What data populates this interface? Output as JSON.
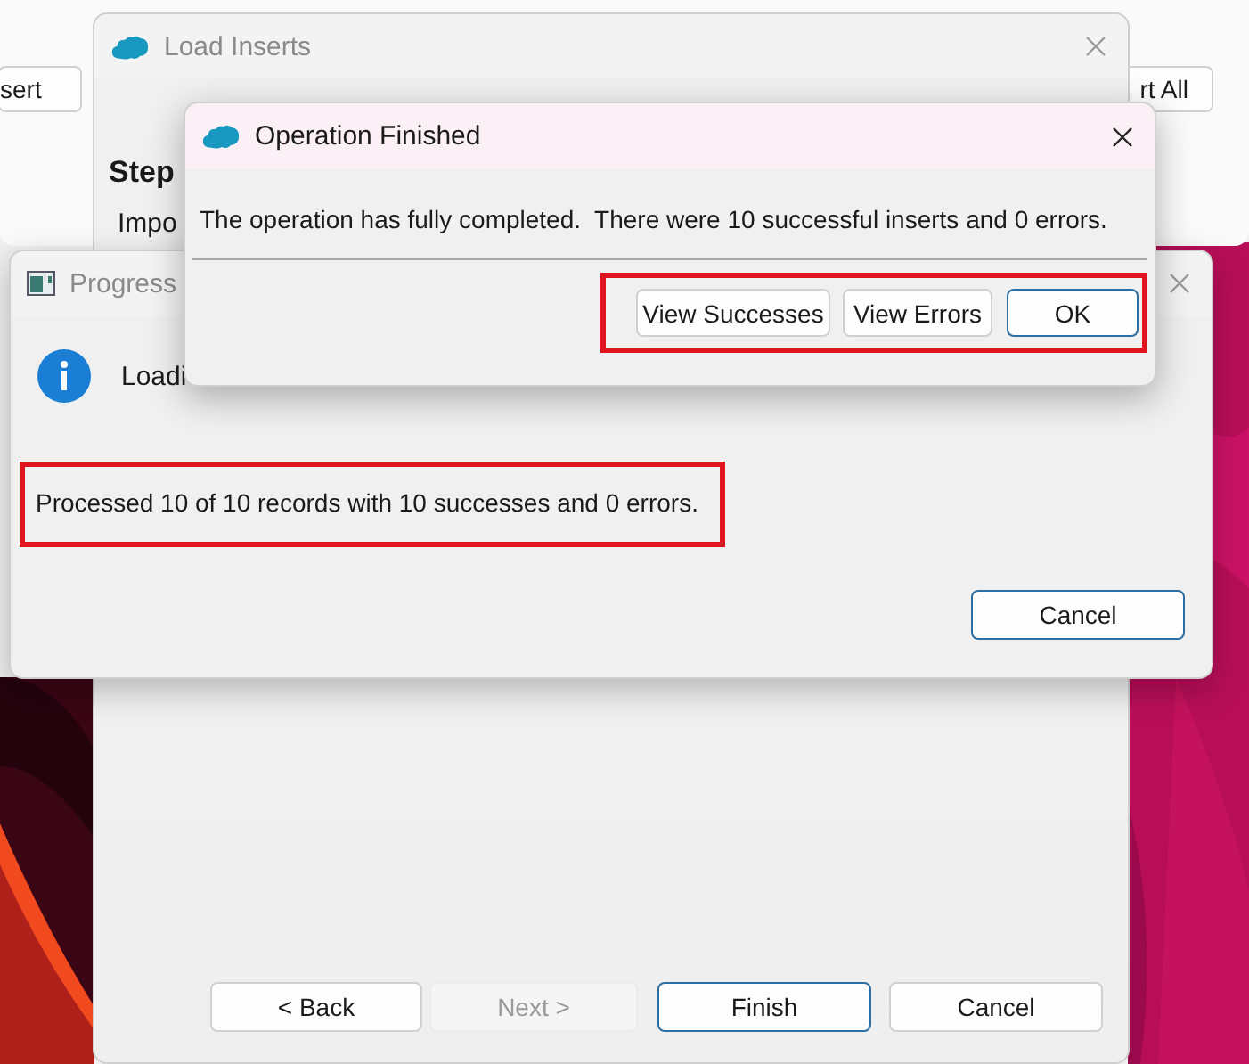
{
  "background_window": {
    "buttons": [
      {
        "label": "sert"
      },
      {
        "label": "rt All"
      }
    ]
  },
  "wizard": {
    "title": "Load Inserts",
    "active": false,
    "heading": "Step",
    "text": "Impo",
    "buttons": [
      {
        "label": "< Back",
        "disabled": false,
        "default": false
      },
      {
        "label": "Next >",
        "disabled": true,
        "default": false
      },
      {
        "label": "Finish",
        "disabled": false,
        "default": true
      },
      {
        "label": "Cancel",
        "disabled": false,
        "default": false
      }
    ]
  },
  "progress": {
    "title": "Progress",
    "active": false,
    "status": "Loadi",
    "message": "Processed 10 of 10 records with 10 successes and 0 errors.",
    "message_highlighted": true,
    "buttons": [
      {
        "label": "Cancel",
        "disabled": false,
        "default": true
      }
    ]
  },
  "operation_dialog": {
    "title": "Operation Finished",
    "active": true,
    "message": "The operation has fully completed.  There were 10 successful inserts and 0 errors.",
    "buttons_highlighted": true,
    "buttons": [
      {
        "label": "View Successes",
        "disabled": false,
        "default": false
      },
      {
        "label": "View Errors",
        "disabled": false,
        "default": false
      },
      {
        "label": "OK",
        "disabled": false,
        "default": true
      }
    ]
  }
}
